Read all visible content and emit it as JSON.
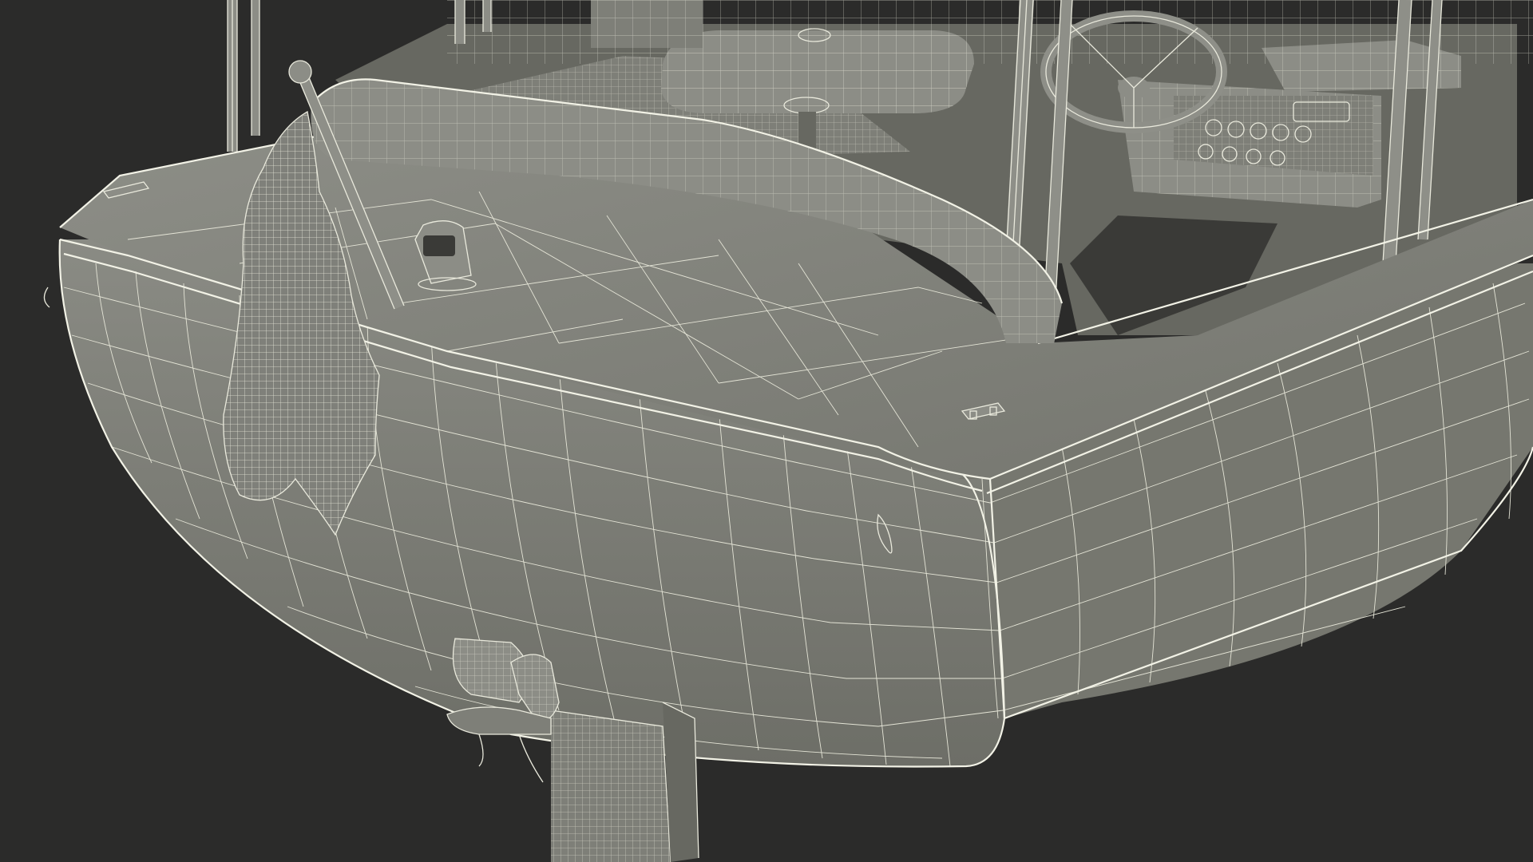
{
  "scene": {
    "subject": "",
    "colors": {
      "background": "#2b2b2a",
      "hull": "#7e7f78",
      "hull_dark": "#676861",
      "hull_light": "#8c8d86",
      "wireframe": "#e9e9dc"
    }
  }
}
